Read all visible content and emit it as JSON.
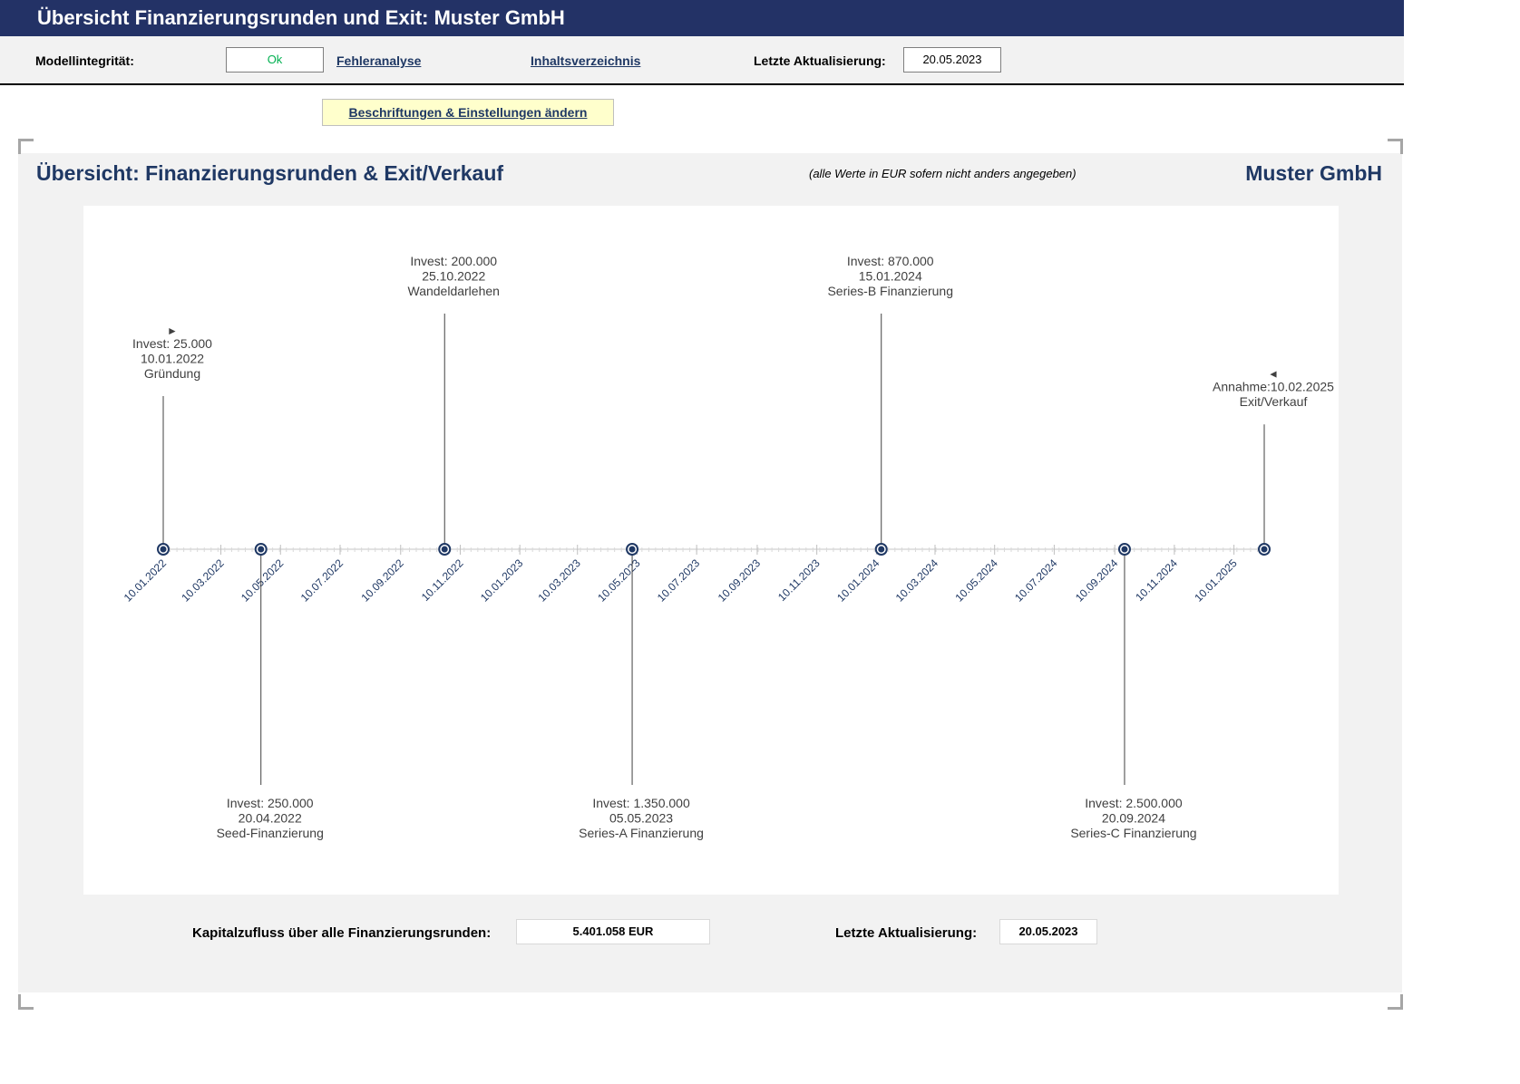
{
  "header": {
    "title": "Übersicht Finanzierungsrunden und Exit: Muster GmbH"
  },
  "toolbar": {
    "integrity_label": "Modellintegrität:",
    "integrity_value": "Ok",
    "error_link": "Fehleranalyse",
    "toc_link": "Inhaltsverzeichnis",
    "updated_label": "Letzte Aktualisierung:",
    "updated_value": "20.05.2023"
  },
  "settings_button": "Beschriftungen & Einstellungen ändern",
  "section": {
    "title": "Übersicht:  Finanzierungsrunden & Exit/Verkauf",
    "note": "(alle Werte in EUR sofern nicht anders angegeben)",
    "company": "Muster GmbH"
  },
  "footer": {
    "capital_label": "Kapitalzufluss über alle Finanzierungsrunden:",
    "capital_value": "5.401.058    EUR",
    "updated_label": "Letzte Aktualisierung:",
    "updated_value": "20.05.2023"
  },
  "colors": {
    "title_bar": "#233266",
    "accent": "#1f3864",
    "ok_text": "#00b050",
    "button_bg": "#ffffcc"
  },
  "chart_data": {
    "type": "timeline",
    "x_range": [
      "10.01.2022",
      "10.02.2025"
    ],
    "ticks": [
      "10.01.2022",
      "10.03.2022",
      "10.05.2022",
      "10.07.2022",
      "10.09.2022",
      "10.11.2022",
      "10.01.2023",
      "10.03.2023",
      "10.05.2023",
      "10.07.2023",
      "10.09.2023",
      "10.11.2023",
      "10.01.2024",
      "10.03.2024",
      "10.05.2024",
      "10.07.2024",
      "10.09.2024",
      "10.11.2024",
      "10.01.2025"
    ],
    "events": [
      {
        "date": "10.01.2022",
        "lines": [
          "Invest: 25.000",
          "10.01.2022",
          "Gründung"
        ],
        "side": "above",
        "stem": 0.65,
        "flag": "►"
      },
      {
        "date": "20.04.2022",
        "lines": [
          "Invest: 250.000",
          "20.04.2022",
          "Seed-Finanzierung"
        ],
        "side": "below",
        "stem": 1.0,
        "flag": ""
      },
      {
        "date": "25.10.2022",
        "lines": [
          "Invest: 200.000",
          "25.10.2022",
          "Wandeldarlehen"
        ],
        "side": "above",
        "stem": 1.0,
        "flag": ""
      },
      {
        "date": "05.05.2023",
        "lines": [
          "Invest: 1.350.000",
          "05.05.2023",
          "Series-A Finanzierung"
        ],
        "side": "below",
        "stem": 1.0,
        "flag": ""
      },
      {
        "date": "15.01.2024",
        "lines": [
          "Invest: 870.000",
          "15.01.2024",
          "Series-B Finanzierung"
        ],
        "side": "above",
        "stem": 1.0,
        "flag": ""
      },
      {
        "date": "20.09.2024",
        "lines": [
          "Invest: 2.500.000",
          "20.09.2024",
          "Series-C Finanzierung"
        ],
        "side": "below",
        "stem": 1.0,
        "flag": ""
      },
      {
        "date": "10.02.2025",
        "lines": [
          "Annahme:10.02.2025",
          "Exit/Verkauf"
        ],
        "side": "above",
        "stem": 0.53,
        "flag": "◄"
      }
    ]
  }
}
